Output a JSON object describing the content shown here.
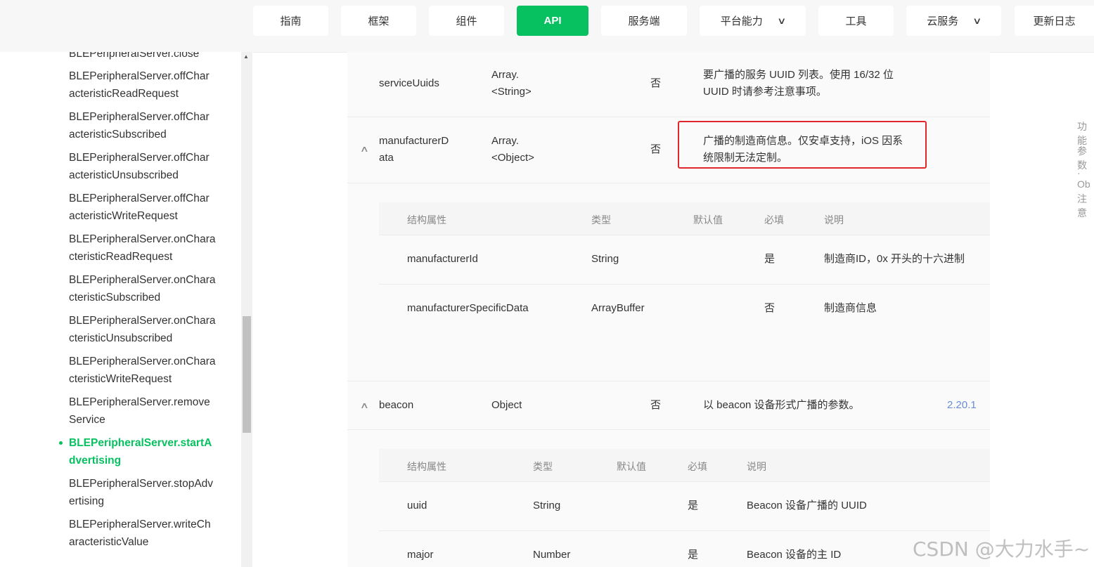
{
  "nav": {
    "items": [
      {
        "label": "指南"
      },
      {
        "label": "框架"
      },
      {
        "label": "组件"
      },
      {
        "label": "API"
      },
      {
        "label": "服务端"
      },
      {
        "label": "平台能力"
      },
      {
        "label": "工具"
      },
      {
        "label": "云服务"
      },
      {
        "label": "更新日志"
      }
    ],
    "chevron": "∨"
  },
  "sidebar": {
    "items": [
      {
        "line1": "BLEPeripheralServer.close",
        "line2": ""
      },
      {
        "line1": "BLEPeripheralServer.offChar",
        "line2": "acteristicReadRequest"
      },
      {
        "line1": "BLEPeripheralServer.offChar",
        "line2": "acteristicSubscribed"
      },
      {
        "line1": "BLEPeripheralServer.offChar",
        "line2": "acteristicUnsubscribed"
      },
      {
        "line1": "BLEPeripheralServer.offChar",
        "line2": "acteristicWriteRequest"
      },
      {
        "line1": "BLEPeripheralServer.onChara",
        "line2": "cteristicReadRequest"
      },
      {
        "line1": "BLEPeripheralServer.onChara",
        "line2": "cteristicSubscribed"
      },
      {
        "line1": "BLEPeripheralServer.onChara",
        "line2": "cteristicUnsubscribed"
      },
      {
        "line1": "BLEPeripheralServer.onChara",
        "line2": "cteristicWriteRequest"
      },
      {
        "line1": "BLEPeripheralServer.remove",
        "line2": "Service"
      },
      {
        "line1": "BLEPeripheralServer.startA",
        "line2": "dvertising"
      },
      {
        "line1": "BLEPeripheralServer.stopAdv",
        "line2": "ertising"
      },
      {
        "line1": "BLEPeripheralServer.writeCh",
        "line2": "aracteristicValue"
      }
    ]
  },
  "table": {
    "rows": [
      {
        "name1": "serviceUuids",
        "name2": "",
        "type1": "Array.",
        "type2": "<String>",
        "required": "否",
        "desc1": "要广播的服务 UUID 列表。使用 16/32 位",
        "desc2": "UUID 时请参考注意事项。"
      },
      {
        "name1": "manufacturerD",
        "name2": "ata",
        "type1": "Array.",
        "type2": "<Object>",
        "required": "否",
        "desc1": "广播的制造商信息。仅安卓支持，iOS 因系",
        "desc2": "统限制无法定制。"
      },
      {
        "name1": "beacon",
        "name2": "",
        "type1": "Object",
        "type2": "",
        "required": "否",
        "desc1": "以 beacon 设备形式广播的参数。",
        "desc2": "",
        "version": "2.20.1"
      }
    ],
    "expand_icon": "∧"
  },
  "sub_tables": {
    "headers": [
      "结构属性",
      "类型",
      "默认值",
      "必填",
      "说明"
    ],
    "manufacturer": [
      {
        "name": "manufacturerId",
        "type": "String",
        "default": "",
        "required": "是",
        "desc": "制造商ID，0x 开头的十六进制"
      },
      {
        "name": "manufacturerSpecificData",
        "type": "ArrayBuffer",
        "default": "",
        "required": "否",
        "desc": "制造商信息"
      }
    ],
    "beacon": [
      {
        "name": "uuid",
        "type": "String",
        "default": "",
        "required": "是",
        "desc": "Beacon 设备广播的 UUID"
      },
      {
        "name": "major",
        "type": "Number",
        "default": "",
        "required": "是",
        "desc": "Beacon 设备的主 ID"
      }
    ]
  },
  "toc": [
    "功能",
    "参数",
    "· Ob",
    "注意"
  ],
  "watermark": "CSDN @大力水手~",
  "colors": {
    "accent": "#07c160",
    "highlight": "#e0262b",
    "version": "#6a8bd8"
  }
}
